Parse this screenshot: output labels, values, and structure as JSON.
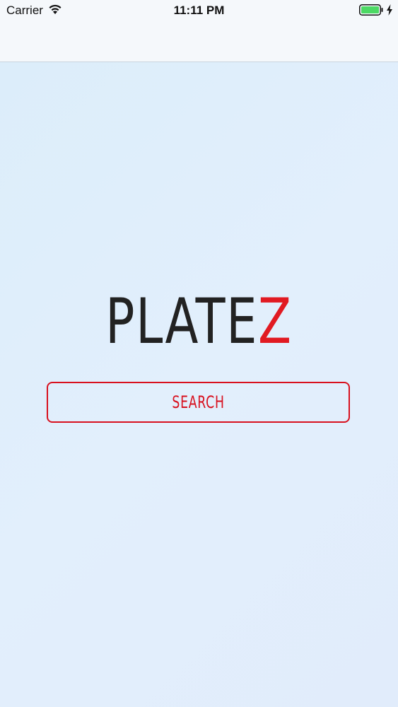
{
  "status_bar": {
    "carrier": "Carrier",
    "time": "11:11 PM",
    "icons": [
      "wifi-icon",
      "battery-icon",
      "charging-icon"
    ]
  },
  "logo": {
    "main": "PLATE",
    "accent": "Z"
  },
  "search_button": {
    "label": "SEARCH"
  },
  "colors": {
    "accent": "#e11a22",
    "logo_text": "#222222",
    "background": "#dfeefb",
    "nav_background": "#f5f8fb",
    "battery": "#4cd964"
  }
}
